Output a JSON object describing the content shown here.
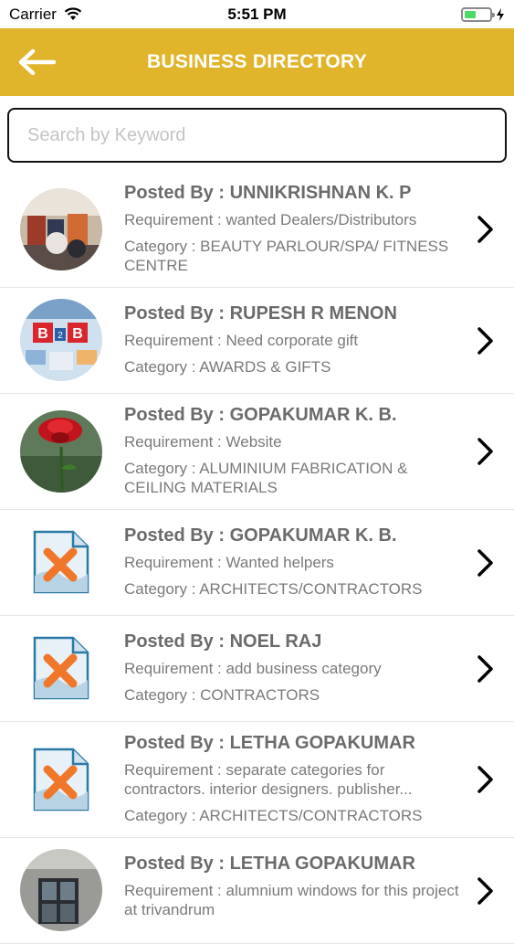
{
  "status": {
    "carrier": "Carrier",
    "time": "5:51 PM"
  },
  "header": {
    "title": "BUSINESS DIRECTORY"
  },
  "search": {
    "placeholder": "Search by Keyword"
  },
  "items": [
    {
      "posted": "Posted By : UNNIKRISHNAN K. P",
      "requirement": "Requirement : wanted Dealers/Distributors",
      "category": "Category : BEAUTY PARLOUR/SPA/ FITNESS CENTRE",
      "image": "photo-store"
    },
    {
      "posted": "Posted By : RUPESH R MENON",
      "requirement": "Requirement : Need corporate gift",
      "category": "Category : AWARDS & GIFTS",
      "image": "photo-b2b"
    },
    {
      "posted": "Posted By : GOPAKUMAR K. B.",
      "requirement": "Requirement : Website",
      "category": "Category : ALUMINIUM FABRICATION & CEILING MATERIALS",
      "image": "photo-rose"
    },
    {
      "posted": "Posted By : GOPAKUMAR K. B.",
      "requirement": "Requirement : Wanted helpers",
      "category": "Category : ARCHITECTS/CONTRACTORS",
      "image": "broken-image-icon"
    },
    {
      "posted": "Posted By : NOEL RAJ",
      "requirement": "Requirement : add business category",
      "category": "Category : CONTRACTORS",
      "image": "broken-image-icon"
    },
    {
      "posted": "Posted By : LETHA GOPAKUMAR",
      "requirement": "Requirement : separate categories for contractors. interior designers. publisher...",
      "category": "Category : ARCHITECTS/CONTRACTORS",
      "image": "broken-image-icon"
    },
    {
      "posted": "Posted By : LETHA GOPAKUMAR",
      "requirement": "Requirement : alumnium windows for this project at trivandrum",
      "category": "",
      "image": "photo-building"
    }
  ],
  "colors": {
    "header": "#e1b52b",
    "text": "#6b6b6b",
    "battery": "#4cd964"
  }
}
